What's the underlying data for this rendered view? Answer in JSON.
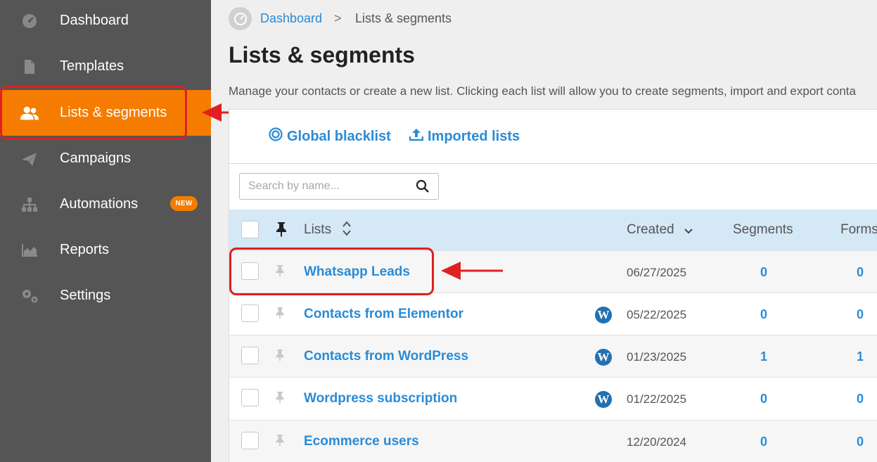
{
  "sidebar": {
    "items": [
      {
        "label": "Dashboard",
        "icon": "dashboard-icon"
      },
      {
        "label": "Templates",
        "icon": "document-icon"
      },
      {
        "label": "Lists & segments",
        "icon": "users-icon",
        "active": true
      },
      {
        "label": "Campaigns",
        "icon": "paper-plane-icon"
      },
      {
        "label": "Automations",
        "icon": "hierarchy-icon",
        "badge": "NEW"
      },
      {
        "label": "Reports",
        "icon": "chart-icon"
      },
      {
        "label": "Settings",
        "icon": "gears-icon"
      }
    ]
  },
  "breadcrumb": {
    "home": "Dashboard",
    "separator": ">",
    "current": "Lists & segments"
  },
  "page": {
    "title": "Lists & segments",
    "description": "Manage your contacts or create a new list. Clicking each list will allow you to create segments, import and export conta"
  },
  "toolbar": {
    "blacklist_label": "Global blacklist",
    "imported_label": "Imported lists"
  },
  "search": {
    "placeholder": "Search by name..."
  },
  "table": {
    "headers": {
      "lists": "Lists",
      "created": "Created",
      "segments": "Segments",
      "forms": "Forms"
    },
    "rows": [
      {
        "name": "Whatsapp Leads",
        "wordpress": false,
        "created": "06/27/2025",
        "segments": "0",
        "forms": "0"
      },
      {
        "name": "Contacts from Elementor",
        "wordpress": true,
        "created": "05/22/2025",
        "segments": "0",
        "forms": "0"
      },
      {
        "name": "Contacts from WordPress",
        "wordpress": true,
        "created": "01/23/2025",
        "segments": "1",
        "forms": "1"
      },
      {
        "name": "Wordpress subscription",
        "wordpress": true,
        "created": "01/22/2025",
        "segments": "0",
        "forms": "0"
      },
      {
        "name": "Ecommerce users",
        "wordpress": false,
        "created": "12/20/2024",
        "segments": "0",
        "forms": "0"
      }
    ]
  },
  "colors": {
    "accent": "#f57c00",
    "link": "#2a8bd6",
    "sidebar": "#555555",
    "header_row": "#d4e8f6",
    "annotation": "#e02020"
  }
}
